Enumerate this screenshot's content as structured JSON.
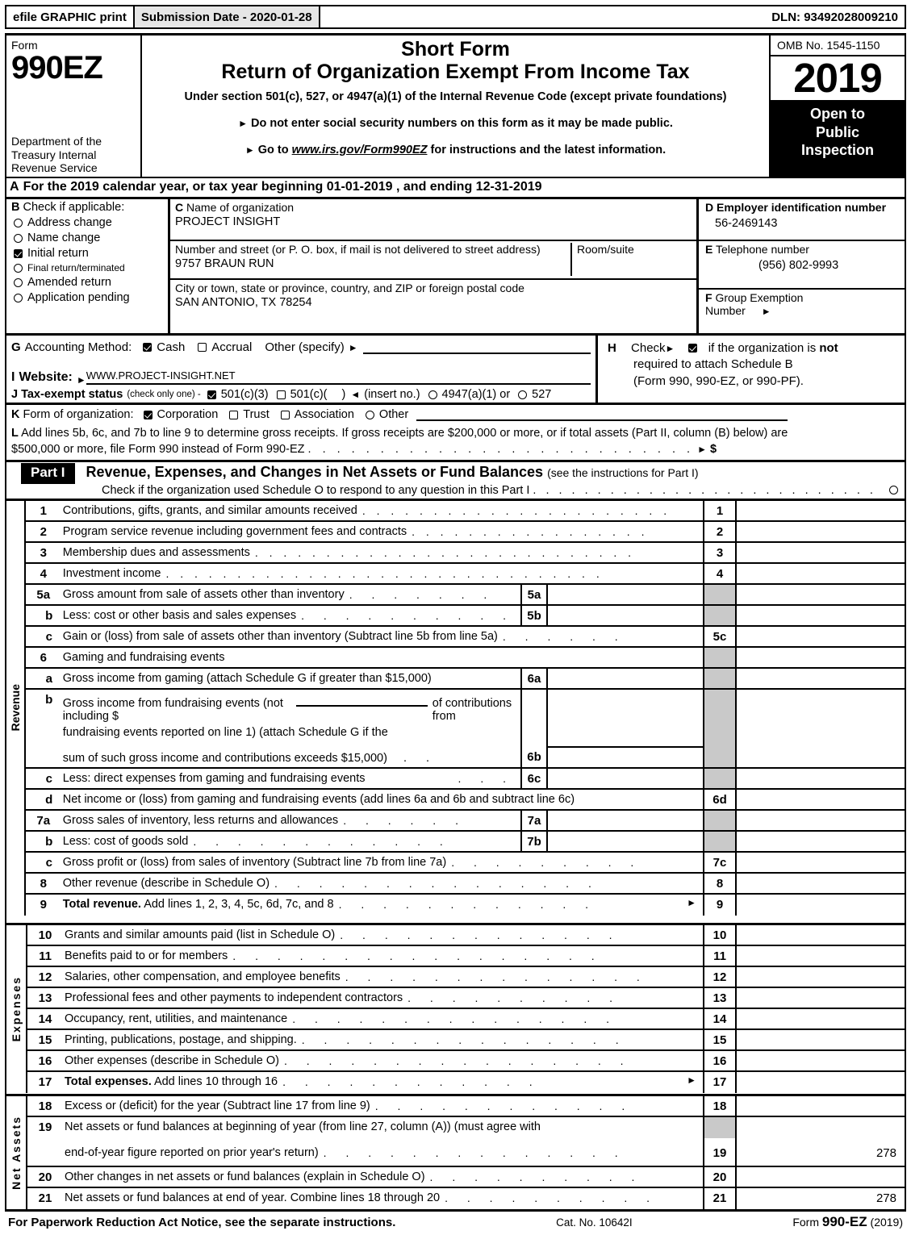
{
  "efile": {
    "graphic_label": "efile GRAPHIC print",
    "submission_label": "Submission Date - 2020-01-28",
    "dln": "DLN: 93492028009210"
  },
  "masthead": {
    "form_label": "Form",
    "form_number": "990EZ",
    "department": "Department of the Treasury Internal Revenue Service",
    "title_1": "Short Form",
    "title_2": "Return of Organization Exempt From Income Tax",
    "subtitle": "Under section 501(c), 527, or 4947(a)(1) of the Internal Revenue Code (except private foundations)",
    "note_1": "Do not enter social security numbers on this form as it may be made public.",
    "note_2_pre": "Go to ",
    "note_2_link": "www.irs.gov/Form990EZ",
    "note_2_post": " for instructions and the latest information.",
    "omb": "OMB No. 1545-1150",
    "year": "2019",
    "open_line1": "Open to",
    "open_line2": "Public",
    "open_line3": "Inspection"
  },
  "lineA": {
    "letter": "A",
    "text": "For the 2019 calendar year, or tax year beginning 01-01-2019 , and ending 12-31-2019"
  },
  "sectionB": {
    "letter": "B",
    "heading": "Check if applicable:",
    "items": [
      {
        "label": "Address change",
        "checked": false,
        "small": false
      },
      {
        "label": "Name change",
        "checked": false,
        "small": false
      },
      {
        "label": "Initial return",
        "checked": true,
        "small": false
      },
      {
        "label": "Final return/terminated",
        "checked": false,
        "small": true
      },
      {
        "label": "Amended return",
        "checked": false,
        "small": false
      },
      {
        "label": "Application pending",
        "checked": false,
        "small": false
      }
    ]
  },
  "sectionC": {
    "letter": "C",
    "name_label": "Name of organization",
    "name_value": "PROJECT INSIGHT",
    "street_label": "Number and street (or P. O. box, if mail is not delivered to street address)",
    "street_value": "9757 BRAUN RUN",
    "room_label": "Room/suite",
    "room_value": "",
    "city_label": "City or town, state or province, country, and ZIP or foreign postal code",
    "city_value": "SAN ANTONIO, TX  78254"
  },
  "sectionD": {
    "letter": "D",
    "label": "Employer identification number",
    "value": "56-2469143"
  },
  "sectionE": {
    "letter": "E",
    "label": "Telephone number",
    "value": "(956) 802-9993"
  },
  "sectionF": {
    "letter": "F",
    "label_line1": "Group Exemption",
    "label_line2": "Number",
    "value": ""
  },
  "sectionG": {
    "letter": "G",
    "label": "Accounting Method:",
    "cash_label": "Cash",
    "cash_checked": true,
    "accrual_label": "Accrual",
    "accrual_checked": false,
    "other_label": "Other (specify)",
    "other_value": ""
  },
  "sectionH": {
    "letter": "H",
    "check_label": "Check",
    "checked": true,
    "text_1": "if the organization is ",
    "text_1_bold": "not",
    "text_2": "required to attach Schedule B",
    "text_3": "(Form 990, 990-EZ, or 990-PF)."
  },
  "sectionI": {
    "letter": "I",
    "label": "Website:",
    "value": "WWW.PROJECT-INSIGHT.NET"
  },
  "sectionJ": {
    "letter": "J",
    "label": "Tax-exempt status",
    "note": "(check only one) -",
    "opt1_label": "501(c)(3)",
    "opt1_checked": true,
    "opt2_label": "501(c)(",
    "opt2_suffix": ")",
    "opt2_value": "",
    "opt2_checked": false,
    "insert_note": "(insert no.)",
    "opt3_label": "4947(a)(1) or",
    "opt3_checked": false,
    "opt4_label": "527",
    "opt4_checked": false
  },
  "sectionK": {
    "letter": "K",
    "label": "Form of organization:",
    "options": [
      {
        "label": "Corporation",
        "checked": true
      },
      {
        "label": "Trust",
        "checked": false
      },
      {
        "label": "Association",
        "checked": false
      },
      {
        "label": "Other",
        "checked": false
      }
    ]
  },
  "sectionL": {
    "letter": "L",
    "text_line1": "Add lines 5b, 6c, and 7b to line 9 to determine gross receipts. If gross receipts are $200,000 or more, or if total assets (Part II, column (B) below) are",
    "text_line2": "$500,000 or more, file Form 990 instead of Form 990-EZ",
    "dollar": "$",
    "value": ""
  },
  "partI": {
    "tag": "Part I",
    "title": "Revenue, Expenses, and Changes in Net Assets or Fund Balances",
    "title_note": "(see the instructions for Part I)",
    "subtitle": "Check if the organization used Schedule O to respond to any question in this Part I",
    "checked": false
  },
  "side_labels": {
    "revenue": "Revenue",
    "expenses": "Expenses",
    "net_assets": "Net Assets"
  },
  "revenue_rows": [
    {
      "num": "1",
      "indent": false,
      "desc": "Contributions, gifts, grants, and similar amounts received",
      "dots": true,
      "sub": null,
      "line": "1",
      "gray": false,
      "value": ""
    },
    {
      "num": "2",
      "indent": false,
      "desc": "Program service revenue including government fees and contracts",
      "dots": true,
      "sub": null,
      "line": "2",
      "gray": false,
      "value": ""
    },
    {
      "num": "3",
      "indent": false,
      "desc": "Membership dues and assessments",
      "dots": true,
      "sub": null,
      "line": "3",
      "gray": false,
      "value": ""
    },
    {
      "num": "4",
      "indent": false,
      "desc": "Investment income",
      "dots": true,
      "sub": null,
      "line": "4",
      "gray": false,
      "value": ""
    },
    {
      "num": "5a",
      "indent": false,
      "desc": "Gross amount from sale of assets other than inventory",
      "dots": true,
      "sub": {
        "label": "5a",
        "value": ""
      },
      "line": "",
      "gray": true,
      "value": ""
    },
    {
      "num": "b",
      "indent": true,
      "desc": "Less: cost or other basis and sales expenses",
      "dots": true,
      "sub": {
        "label": "5b",
        "value": ""
      },
      "line": "",
      "gray": true,
      "value": ""
    },
    {
      "num": "c",
      "indent": true,
      "desc": "Gain or (loss) from sale of assets other than inventory (Subtract line 5b from line 5a)",
      "dots": true,
      "sub": null,
      "line": "5c",
      "gray": false,
      "value": ""
    },
    {
      "num": "6",
      "indent": false,
      "desc": "Gaming and fundraising events",
      "dots": false,
      "sub": null,
      "line": "",
      "gray": true,
      "value": ""
    },
    {
      "num": "a",
      "indent": true,
      "desc": "Gross income from gaming (attach Schedule G if greater than $15,000)",
      "dots": false,
      "sub": {
        "label": "6a",
        "value": ""
      },
      "line": "",
      "gray": true,
      "value": ""
    }
  ],
  "revenue_6b": {
    "num": "b",
    "line1_a": "Gross income from fundraising events (not including $",
    "line1_b": "of contributions from",
    "line2": "fundraising events reported on line 1) (attach Schedule G if the",
    "line3": "sum of such gross income and contributions exceeds $15,000)",
    "blank_value": "",
    "sub_label": "6b",
    "sub_value": ""
  },
  "revenue_rows2": [
    {
      "num": "c",
      "indent": true,
      "desc": "Less: direct expenses from gaming and fundraising events",
      "dots": true,
      "sub": {
        "label": "6c",
        "value": ""
      },
      "line": "",
      "gray": true,
      "value": ""
    },
    {
      "num": "d",
      "indent": true,
      "desc": "Net income or (loss) from gaming and fundraising events (add lines 6a and 6b and subtract line 6c)",
      "dots": false,
      "sub": null,
      "line": "6d",
      "gray": false,
      "value": ""
    },
    {
      "num": "7a",
      "indent": false,
      "desc": "Gross sales of inventory, less returns and allowances",
      "dots": true,
      "sub": {
        "label": "7a",
        "value": ""
      },
      "line": "",
      "gray": true,
      "value": ""
    },
    {
      "num": "b",
      "indent": true,
      "desc": "Less: cost of goods sold",
      "dots": true,
      "sub": {
        "label": "7b",
        "value": ""
      },
      "line": "",
      "gray": true,
      "value": ""
    },
    {
      "num": "c",
      "indent": true,
      "desc": "Gross profit or (loss) from sales of inventory (Subtract line 7b from line 7a)",
      "dots": true,
      "sub": null,
      "line": "7c",
      "gray": false,
      "value": ""
    },
    {
      "num": "8",
      "indent": false,
      "desc": "Other revenue (describe in Schedule O)",
      "dots": true,
      "sub": null,
      "line": "8",
      "gray": false,
      "value": ""
    },
    {
      "num": "9",
      "indent": false,
      "desc": "Total revenue.",
      "desc_rest": " Add lines 1, 2, 3, 4, 5c, 6d, 7c, and 8",
      "bold_lead": true,
      "dots": true,
      "arrow": true,
      "sub": null,
      "line": "9",
      "gray": false,
      "value": ""
    }
  ],
  "expense_rows": [
    {
      "num": "10",
      "desc": "Grants and similar amounts paid (list in Schedule O)",
      "line": "10",
      "value": ""
    },
    {
      "num": "11",
      "desc": "Benefits paid to or for members",
      "line": "11",
      "value": ""
    },
    {
      "num": "12",
      "desc": "Salaries, other compensation, and employee benefits",
      "line": "12",
      "value": ""
    },
    {
      "num": "13",
      "desc": "Professional fees and other payments to independent contractors",
      "line": "13",
      "value": ""
    },
    {
      "num": "14",
      "desc": "Occupancy, rent, utilities, and maintenance",
      "line": "14",
      "value": ""
    },
    {
      "num": "15",
      "desc": "Printing, publications, postage, and shipping.",
      "line": "15",
      "value": ""
    },
    {
      "num": "16",
      "desc": "Other expenses (describe in Schedule O)",
      "line": "16",
      "value": ""
    },
    {
      "num": "17",
      "desc": "Total expenses.",
      "desc_rest": " Add lines 10 through 16",
      "bold_lead": true,
      "arrow": true,
      "line": "17",
      "value": ""
    }
  ],
  "netassets_rows": [
    {
      "num": "18",
      "desc": "Excess or (deficit) for the year (Subtract line 17 from line 9)",
      "line": "18",
      "gray": false,
      "value": ""
    },
    {
      "num": "19",
      "desc_line1": "Net assets or fund balances at beginning of year (from line 27, column (A)) (must agree with",
      "desc_line2": "end-of-year figure reported on prior year's return)",
      "line": "19",
      "gray_top": true,
      "value": "278"
    },
    {
      "num": "20",
      "desc": "Other changes in net assets or fund balances (explain in Schedule O)",
      "line": "20",
      "gray": false,
      "value": ""
    },
    {
      "num": "21",
      "desc": "Net assets or fund balances at end of year. Combine lines 18 through 20",
      "line": "21",
      "gray": false,
      "value": "278"
    }
  ],
  "footer": {
    "notice": "For Paperwork Reduction Act Notice, see the separate instructions.",
    "cat": "Cat. No. 10642I",
    "form_pre": "Form ",
    "form_bold": "990-EZ",
    "form_year": " (2019)"
  }
}
